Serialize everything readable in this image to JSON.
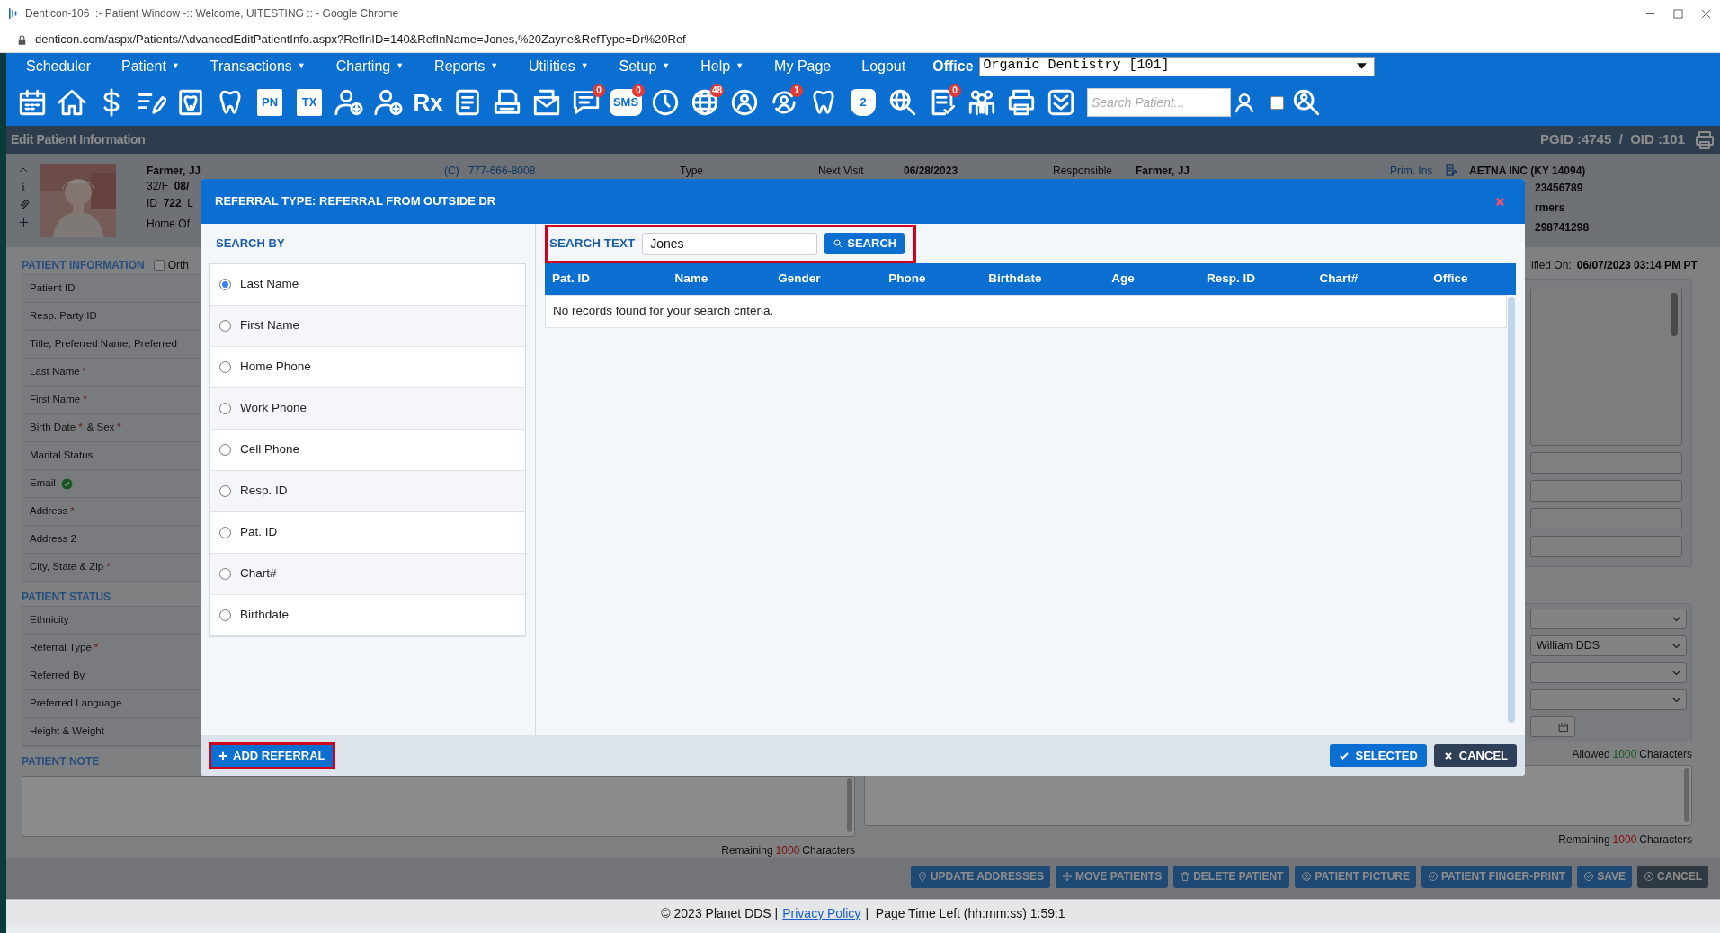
{
  "browser": {
    "title": "Denticon-106 ::- Patient Window -:: Welcome, UITESTING :: - Google Chrome",
    "url": "denticon.com/aspx/Patients/AdvancedEditPatientInfo.aspx?RefInID=140&RefInName=Jones,%20Zayne&RefType=Dr%20Ref"
  },
  "menu": [
    {
      "label": "Scheduler"
    },
    {
      "label": "Patient",
      "caret": "▼"
    },
    {
      "label": "Transactions",
      "caret": "▼"
    },
    {
      "label": "Charting",
      "caret": "▼"
    },
    {
      "label": "Reports",
      "caret": "▼"
    },
    {
      "label": "Utilities",
      "caret": "▼"
    },
    {
      "label": "Setup",
      "caret": "▼"
    },
    {
      "label": "Help",
      "caret": "▼"
    },
    {
      "label": "My Page"
    },
    {
      "label": "Logout"
    }
  ],
  "office": {
    "label": "Office",
    "value": "Organic Dentistry [101]"
  },
  "toolbar": [
    {
      "kind": "calendar"
    },
    {
      "kind": "home"
    },
    {
      "kind": "dollar"
    },
    {
      "kind": "edit-list"
    },
    {
      "kind": "tooth-document"
    },
    {
      "kind": "tooth"
    },
    {
      "kind": "document",
      "label": "PN"
    },
    {
      "kind": "document",
      "label": "TX"
    },
    {
      "kind": "person-add"
    },
    {
      "kind": "person-add"
    },
    {
      "kind": "plain",
      "label": "Rx"
    },
    {
      "kind": "list-document"
    },
    {
      "kind": "print-document"
    },
    {
      "kind": "envelope"
    },
    {
      "kind": "chat",
      "badge": "0"
    },
    {
      "kind": "chat",
      "label": "SMS",
      "badge": "0"
    },
    {
      "kind": "clock"
    },
    {
      "kind": "globe",
      "badge": "48"
    },
    {
      "kind": "globe-people"
    },
    {
      "kind": "person-sync",
      "badge": "1"
    },
    {
      "kind": "tooth"
    },
    {
      "kind": "tooth",
      "label": "2"
    },
    {
      "kind": "globe-search"
    },
    {
      "kind": "document-check",
      "badge": "0"
    },
    {
      "kind": "people"
    },
    {
      "kind": "printer"
    },
    {
      "kind": "chevrons"
    }
  ],
  "patient_search": {
    "placeholder": "Search Patient..."
  },
  "toolbar_checkbox": {
    "checked": false
  },
  "header": {
    "title": "Edit Patient Information",
    "ids": "PGID :4745  /  OID :101"
  },
  "patient": {
    "name": "Farmer, JJ",
    "line_2": "32/F  **08/**",
    "line_3": "ID  **722**  L",
    "line_4": "Home Of",
    "phone": "(C)   777-666-8008",
    "type_label": "Type",
    "next_visit_label": "Next Visit",
    "next_visit": "06/28/2023",
    "responsible_label": "Responsible",
    "responsible": "Farmer, JJ",
    "insurance_label": "Prim. Ins",
    "insurance": "AETNA INC (KY 14094)",
    "insurance_lines": [
      "23456789",
      "rmers",
      "298741298"
    ]
  },
  "form": {
    "sections": [
      {
        "title": "PATIENT INFORMATION",
        "checkbox": {
          "label": "Orth",
          "checked": false
        },
        "rows": [
          {
            "label": "Patient ID"
          },
          {
            "label": "Resp. Party ID"
          },
          {
            "label": "Title, Preferred Name, Preferred"
          },
          {
            "label": "Last Name",
            "mark": "*"
          },
          {
            "label": "First Name",
            "mark": "*"
          },
          {
            "label": "Birth Date",
            "mark": "*",
            "label_2": "& Sex",
            "mark_2": "*"
          },
          {
            "label": "Marital Status"
          },
          {
            "label": "Email",
            "verified": true
          },
          {
            "label": "Address",
            "mark": "*"
          },
          {
            "label": "Address 2"
          },
          {
            "label": "City, State & Zip",
            "mark": "*"
          }
        ]
      },
      {
        "title": "PATIENT STATUS",
        "rows": [
          {
            "label": "Ethnicity"
          },
          {
            "label": "Referral Type",
            "mark": "*"
          },
          {
            "label": "Referred By"
          },
          {
            "label": "Preferred Language"
          },
          {
            "label": "Height & Weight"
          }
        ]
      },
      {
        "title": "PATIENT NOTE"
      }
    ]
  },
  "right": {
    "modified_label": "ified On:",
    "modified_value": "06/07/2023 03:14 PM PT",
    "referred_by": "William DDS",
    "allowed": {
      "prefix": "Allowed",
      "count": "1000",
      "suffix": "Characters"
    },
    "remaining": [
      {
        "prefix": "Remaining",
        "count": "1000",
        "suffix": "Characters"
      },
      {
        "prefix": "Remaining",
        "count": "1000",
        "suffix": "Characters"
      }
    ]
  },
  "actions": [
    {
      "label": "UPDATE ADDRESSES",
      "kind": "marker"
    },
    {
      "label": "MOVE PATIENTS",
      "kind": "move"
    },
    {
      "label": "DELETE PATIENT",
      "kind": "trash"
    },
    {
      "label": "PATIENT PICTURE",
      "kind": "user"
    },
    {
      "label": "PATIENT FINGER-PRINT",
      "kind": "check"
    },
    {
      "label": "SAVE",
      "kind": "check"
    },
    {
      "label": "CANCEL",
      "kind": "close",
      "dark": true
    }
  ],
  "footer": {
    "copyright": "© 2023 Planet DDS |",
    "link": "Privacy Policy",
    "rest": "|  Page Time Left (hh:mm:ss) 1:59:1"
  },
  "modal": {
    "title": "REFERRAL TYPE: REFERRAL FROM OUTSIDE DR",
    "search_by": "SEARCH BY",
    "options": [
      {
        "label": "Last Name",
        "selected": true
      },
      {
        "label": "First Name",
        "selected": false
      },
      {
        "label": "Home Phone",
        "selected": false
      },
      {
        "label": "Work Phone",
        "selected": false
      },
      {
        "label": "Cell Phone",
        "selected": false
      },
      {
        "label": "Resp. ID",
        "selected": false
      },
      {
        "label": "Pat. ID",
        "selected": false
      },
      {
        "label": "Chart#",
        "selected": false
      },
      {
        "label": "Birthdate",
        "selected": false
      }
    ],
    "search_label": "SEARCH TEXT",
    "search_value": "Jones",
    "search_button": "SEARCH",
    "search_highlighted": true,
    "columns": [
      "Pat. ID",
      "Name",
      "Gender",
      "Phone",
      "Birthdate",
      "Age",
      "Resp. ID",
      "Chart#",
      "Office"
    ],
    "empty_message": "No records found for your search criteria.",
    "add_button": {
      "label": "ADD REFERRAL",
      "highlighted": true
    },
    "buttons": [
      {
        "label": "SELECTED",
        "kind": "check"
      },
      {
        "label": "CANCEL",
        "kind": "close"
      }
    ]
  }
}
